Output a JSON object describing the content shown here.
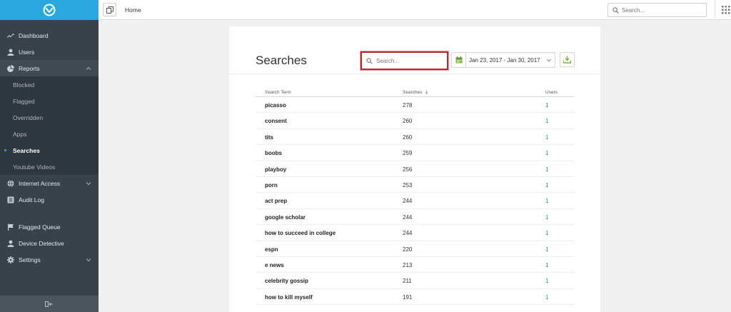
{
  "topbar": {
    "home_label": "Home",
    "search_placeholder": "Search..."
  },
  "sidebar": {
    "items": [
      {
        "label": "Dashboard",
        "icon": "chart-line-icon"
      },
      {
        "label": "Users",
        "icon": "user-icon"
      },
      {
        "label": "Reports",
        "icon": "pie-chart-icon"
      }
    ],
    "reports_sub": [
      {
        "label": "Blocked"
      },
      {
        "label": "Flagged"
      },
      {
        "label": "Overridden"
      },
      {
        "label": "Apps"
      },
      {
        "label": "Searches"
      },
      {
        "label": "Youtube Videos"
      }
    ],
    "items2": [
      {
        "label": "Internet Access",
        "icon": "globe-icon"
      },
      {
        "label": "Audit Log",
        "icon": "list-icon"
      }
    ],
    "items3": [
      {
        "label": "Flagged Queue",
        "icon": "flag-icon"
      },
      {
        "label": "Device Detective",
        "icon": "user-icon"
      },
      {
        "label": "Settings",
        "icon": "gear-icon"
      }
    ]
  },
  "main": {
    "title": "Searches",
    "search_placeholder": "Search...",
    "date_range": "Jan 23, 2017 - Jan 30, 2017",
    "table": {
      "columns": [
        "Search Term",
        "Searches",
        "Users"
      ],
      "rows": [
        {
          "term": "picasso",
          "searches": "278",
          "users": "1"
        },
        {
          "term": "consent",
          "searches": "260",
          "users": "1"
        },
        {
          "term": "tits",
          "searches": "260",
          "users": "1"
        },
        {
          "term": "boobs",
          "searches": "259",
          "users": "1"
        },
        {
          "term": "playboy",
          "searches": "256",
          "users": "1"
        },
        {
          "term": "porn",
          "searches": "253",
          "users": "1"
        },
        {
          "term": "act prep",
          "searches": "244",
          "users": "1"
        },
        {
          "term": "google scholar",
          "searches": "244",
          "users": "1"
        },
        {
          "term": "how to succeed in college",
          "searches": "244",
          "users": "1"
        },
        {
          "term": "espn",
          "searches": "220",
          "users": "1"
        },
        {
          "term": "e news",
          "searches": "213",
          "users": "1"
        },
        {
          "term": "celebrity gossip",
          "searches": "211",
          "users": "1"
        },
        {
          "term": "how to kill myself",
          "searches": "191",
          "users": "1"
        }
      ]
    }
  },
  "colors": {
    "brand": "#29a8e0",
    "sidebar": "#37424a",
    "highlight": "#b52a2a",
    "link": "#2a7fc4",
    "calendar": "#7cb342"
  }
}
